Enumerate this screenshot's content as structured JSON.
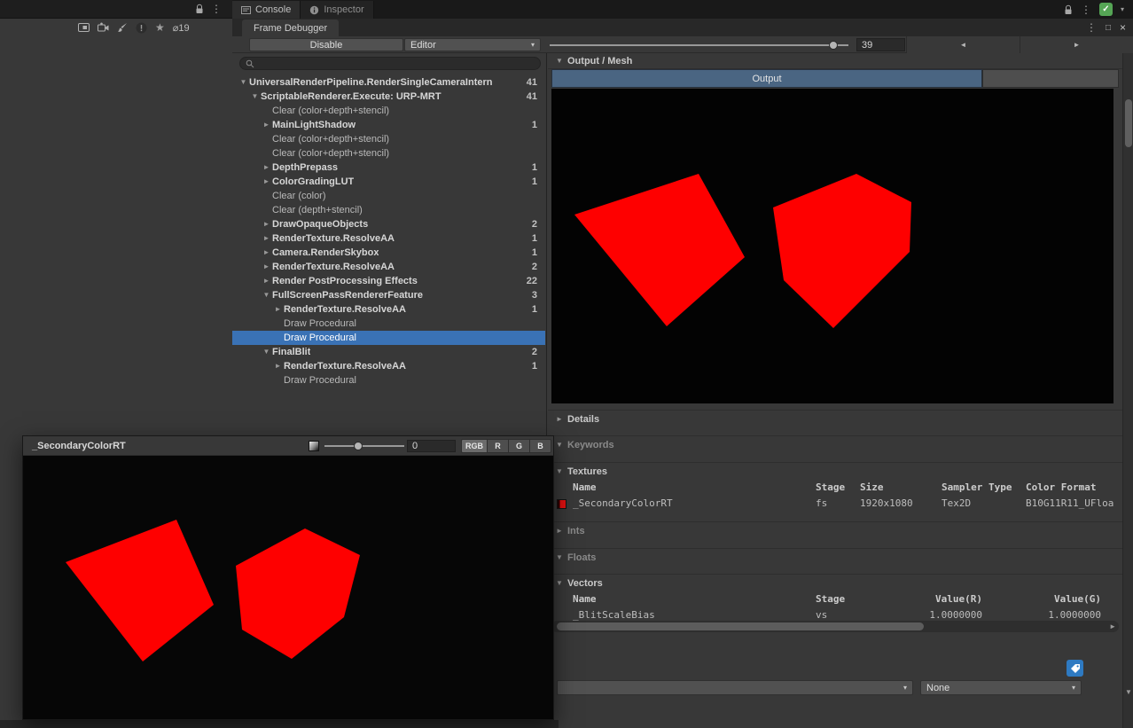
{
  "colors": {
    "selection_blue": "#3a72b5",
    "output_tab_blue": "#4a6582",
    "shape_red": "#fe0000",
    "tag_blue": "#2e7ac2",
    "badge_green": "#55a555"
  },
  "icons": {
    "kebab": "⋮",
    "close": "×",
    "restore": "□",
    "caret_down": "▾",
    "foldout_open": "▼",
    "foldout_closed": "►",
    "prev_arrow": "◄",
    "next_arrow": "►",
    "check": "✓",
    "star": "★",
    "scroll_down": "▼",
    "scroll_right": "►"
  },
  "top_bar": {
    "tabs": [
      {
        "label": "Console"
      },
      {
        "label": "Inspector"
      }
    ],
    "hidden_count": "⌀19"
  },
  "frame_debugger": {
    "tab_label": "Frame Debugger",
    "disable_button": "Disable",
    "target_dropdown": "Editor",
    "frame_number": "39"
  },
  "tree": {
    "search_placeholder": "",
    "items": [
      {
        "label": "UniversalRenderPipeline.RenderSingleCameraIntern",
        "count": "41",
        "depth": 0,
        "arrow": "open",
        "bold": true,
        "selected": false
      },
      {
        "label": "ScriptableRenderer.Execute: URP-MRT",
        "count": "41",
        "depth": 1,
        "arrow": "open",
        "bold": true,
        "selected": false
      },
      {
        "label": "Clear (color+depth+stencil)",
        "count": "",
        "depth": 2,
        "arrow": "none",
        "bold": false,
        "selected": false
      },
      {
        "label": "MainLightShadow",
        "count": "1",
        "depth": 2,
        "arrow": "closed",
        "bold": true,
        "selected": false
      },
      {
        "label": "Clear (color+depth+stencil)",
        "count": "",
        "depth": 2,
        "arrow": "none",
        "bold": false,
        "selected": false
      },
      {
        "label": "Clear (color+depth+stencil)",
        "count": "",
        "depth": 2,
        "arrow": "none",
        "bold": false,
        "selected": false
      },
      {
        "label": "DepthPrepass",
        "count": "1",
        "depth": 2,
        "arrow": "closed",
        "bold": true,
        "selected": false
      },
      {
        "label": "ColorGradingLUT",
        "count": "1",
        "depth": 2,
        "arrow": "closed",
        "bold": true,
        "selected": false
      },
      {
        "label": "Clear (color)",
        "count": "",
        "depth": 2,
        "arrow": "none",
        "bold": false,
        "selected": false
      },
      {
        "label": "Clear (depth+stencil)",
        "count": "",
        "depth": 2,
        "arrow": "none",
        "bold": false,
        "selected": false
      },
      {
        "label": "DrawOpaqueObjects",
        "count": "2",
        "depth": 2,
        "arrow": "closed",
        "bold": true,
        "selected": false
      },
      {
        "label": "RenderTexture.ResolveAA",
        "count": "1",
        "depth": 2,
        "arrow": "closed",
        "bold": true,
        "selected": false
      },
      {
        "label": "Camera.RenderSkybox",
        "count": "1",
        "depth": 2,
        "arrow": "closed",
        "bold": true,
        "selected": false
      },
      {
        "label": "RenderTexture.ResolveAA",
        "count": "2",
        "depth": 2,
        "arrow": "closed",
        "bold": true,
        "selected": false
      },
      {
        "label": "Render PostProcessing Effects",
        "count": "22",
        "depth": 2,
        "arrow": "closed",
        "bold": true,
        "selected": false
      },
      {
        "label": "FullScreenPassRendererFeature",
        "count": "3",
        "depth": 2,
        "arrow": "open",
        "bold": true,
        "selected": false
      },
      {
        "label": "RenderTexture.ResolveAA",
        "count": "1",
        "depth": 3,
        "arrow": "closed",
        "bold": true,
        "selected": false
      },
      {
        "label": "Draw Procedural",
        "count": "",
        "depth": 3,
        "arrow": "none",
        "bold": false,
        "selected": false
      },
      {
        "label": "Draw Procedural",
        "count": "",
        "depth": 3,
        "arrow": "none",
        "bold": false,
        "selected": true
      },
      {
        "label": "FinalBlit",
        "count": "2",
        "depth": 2,
        "arrow": "open",
        "bold": true,
        "selected": false
      },
      {
        "label": "RenderTexture.ResolveAA",
        "count": "1",
        "depth": 3,
        "arrow": "closed",
        "bold": true,
        "selected": false
      },
      {
        "label": "Draw Procedural",
        "count": "",
        "depth": 3,
        "arrow": "none",
        "bold": false,
        "selected": false
      }
    ]
  },
  "output_panel": {
    "header": "Output / Mesh",
    "output_tab": "Output",
    "details_label": "Details",
    "keywords_label": "Keywords",
    "ints_label": "Ints",
    "floats_label": "Floats",
    "textures": {
      "label": "Textures",
      "headers": {
        "name": "Name",
        "stage": "Stage",
        "size": "Size",
        "sampler": "Sampler Type",
        "format": "Color Format"
      },
      "rows": [
        {
          "name": "_SecondaryColorRT",
          "stage": "fs",
          "size": "1920x1080",
          "sampler": "Tex2D",
          "format": "B10G11R11_UFloa"
        }
      ]
    },
    "vectors": {
      "label": "Vectors",
      "headers": {
        "name": "Name",
        "stage": "Stage",
        "r": "Value(R)",
        "g": "Value(G)"
      },
      "rows": [
        {
          "name": "_BlitScaleBias",
          "stage": "vs",
          "r": "1.0000000",
          "g": "1.0000000"
        }
      ]
    },
    "shapes": [
      "26,142 166,96 218,190 130,268",
      "250,134 344,96 406,128 404,184 318,270 262,216"
    ],
    "bottom": {
      "left_value": "",
      "right_value": "None"
    }
  },
  "preview_window": {
    "title": "_SecondaryColorRT",
    "exposure_value": "0",
    "channel_buttons": [
      {
        "label": "RGB",
        "active": true
      },
      {
        "label": "R",
        "active": false
      },
      {
        "label": "G",
        "active": false
      },
      {
        "label": "B",
        "active": false
      }
    ],
    "shapes": [
      "48,120 173,72 215,168 135,232",
      "240,124 318,82 380,112 362,182 303,229 247,196"
    ]
  }
}
